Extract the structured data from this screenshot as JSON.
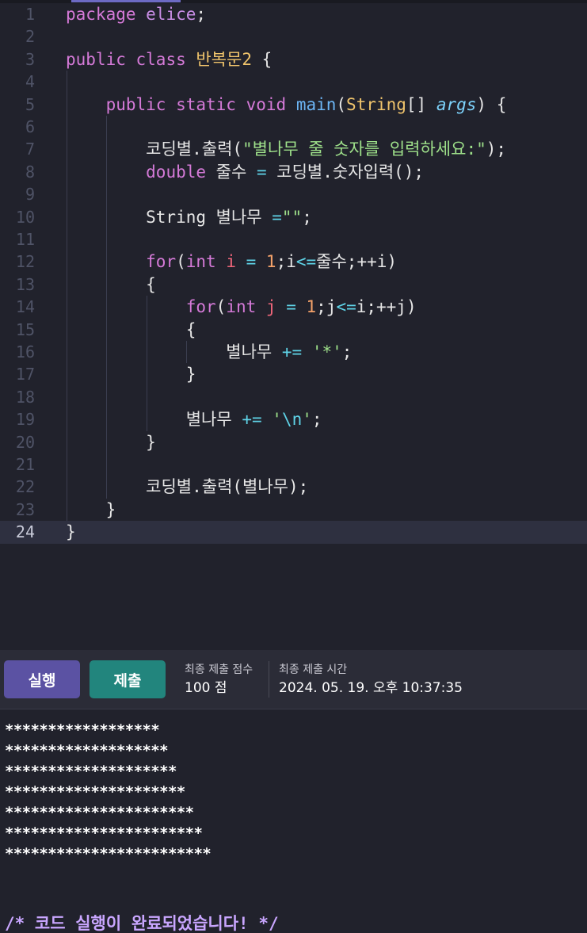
{
  "editor": {
    "active_line": 24,
    "lines": [
      {
        "n": "1",
        "tokens": [
          {
            "t": "package ",
            "c": "kw"
          },
          {
            "t": "elice",
            "c": "mod"
          },
          {
            "t": ";",
            "c": "plain"
          }
        ]
      },
      {
        "n": "2",
        "tokens": []
      },
      {
        "n": "3",
        "tokens": [
          {
            "t": "public ",
            "c": "kw"
          },
          {
            "t": "class ",
            "c": "kw"
          },
          {
            "t": "반복문2",
            "c": "cls"
          },
          {
            "t": " {",
            "c": "plain"
          }
        ]
      },
      {
        "n": "4",
        "tokens": []
      },
      {
        "n": "5",
        "tokens": [
          {
            "t": "    public ",
            "c": "kw"
          },
          {
            "t": "static ",
            "c": "kw"
          },
          {
            "t": "void ",
            "c": "kw"
          },
          {
            "t": "main",
            "c": "fn"
          },
          {
            "t": "(",
            "c": "plain"
          },
          {
            "t": "String",
            "c": "type"
          },
          {
            "t": "[] ",
            "c": "plain"
          },
          {
            "t": "args",
            "c": "param"
          },
          {
            "t": ") {",
            "c": "plain"
          }
        ]
      },
      {
        "n": "6",
        "tokens": []
      },
      {
        "n": "7",
        "tokens": [
          {
            "t": "        코딩별.출력(",
            "c": "plain"
          },
          {
            "t": "\"별나무 줄 숫자를 입력하세요:\"",
            "c": "str"
          },
          {
            "t": ");",
            "c": "plain"
          }
        ]
      },
      {
        "n": "8",
        "tokens": [
          {
            "t": "        ",
            "c": "plain"
          },
          {
            "t": "double ",
            "c": "kw"
          },
          {
            "t": "줄수 ",
            "c": "plain"
          },
          {
            "t": "=",
            "c": "op"
          },
          {
            "t": " 코딩별.숫자입력();",
            "c": "plain"
          }
        ]
      },
      {
        "n": "9",
        "tokens": []
      },
      {
        "n": "10",
        "tokens": [
          {
            "t": "        String 별나무 ",
            "c": "plain"
          },
          {
            "t": "=",
            "c": "op"
          },
          {
            "t": "\"\"",
            "c": "str"
          },
          {
            "t": ";",
            "c": "plain"
          }
        ]
      },
      {
        "n": "11",
        "tokens": []
      },
      {
        "n": "12",
        "tokens": [
          {
            "t": "        ",
            "c": "plain"
          },
          {
            "t": "for",
            "c": "kw"
          },
          {
            "t": "(",
            "c": "plain"
          },
          {
            "t": "int ",
            "c": "kw"
          },
          {
            "t": "i",
            "c": "var"
          },
          {
            "t": " = ",
            "c": "op"
          },
          {
            "t": "1",
            "c": "num"
          },
          {
            "t": ";i",
            "c": "plain"
          },
          {
            "t": "<=",
            "c": "op"
          },
          {
            "t": "줄수;++i)",
            "c": "plain"
          }
        ]
      },
      {
        "n": "13",
        "tokens": [
          {
            "t": "        {",
            "c": "plain"
          }
        ]
      },
      {
        "n": "14",
        "tokens": [
          {
            "t": "            ",
            "c": "plain"
          },
          {
            "t": "for",
            "c": "kw"
          },
          {
            "t": "(",
            "c": "plain"
          },
          {
            "t": "int ",
            "c": "kw"
          },
          {
            "t": "j",
            "c": "var"
          },
          {
            "t": " = ",
            "c": "op"
          },
          {
            "t": "1",
            "c": "num"
          },
          {
            "t": ";j",
            "c": "plain"
          },
          {
            "t": "<=",
            "c": "op"
          },
          {
            "t": "i;++j)",
            "c": "plain"
          }
        ]
      },
      {
        "n": "15",
        "tokens": [
          {
            "t": "            {",
            "c": "plain"
          }
        ]
      },
      {
        "n": "16",
        "tokens": [
          {
            "t": "                별나무 ",
            "c": "plain"
          },
          {
            "t": "+=",
            "c": "op"
          },
          {
            "t": " ",
            "c": "plain"
          },
          {
            "t": "'*'",
            "c": "str"
          },
          {
            "t": ";",
            "c": "plain"
          }
        ]
      },
      {
        "n": "17",
        "tokens": [
          {
            "t": "            }",
            "c": "plain"
          }
        ]
      },
      {
        "n": "18",
        "tokens": []
      },
      {
        "n": "19",
        "tokens": [
          {
            "t": "            별나무 ",
            "c": "plain"
          },
          {
            "t": "+=",
            "c": "op"
          },
          {
            "t": " ",
            "c": "plain"
          },
          {
            "t": "'",
            "c": "str"
          },
          {
            "t": "\\n",
            "c": "esc"
          },
          {
            "t": "'",
            "c": "str"
          },
          {
            "t": ";",
            "c": "plain"
          }
        ]
      },
      {
        "n": "20",
        "tokens": [
          {
            "t": "        }",
            "c": "plain"
          }
        ]
      },
      {
        "n": "21",
        "tokens": []
      },
      {
        "n": "22",
        "tokens": [
          {
            "t": "        코딩별.출력(별나무);",
            "c": "plain"
          }
        ]
      },
      {
        "n": "23",
        "tokens": [
          {
            "t": "    }",
            "c": "plain"
          }
        ]
      },
      {
        "n": "24",
        "tokens": [
          {
            "t": "}",
            "c": "plain"
          }
        ]
      }
    ]
  },
  "toolbar": {
    "run_label": "실행",
    "submit_label": "제출",
    "score_label": "최종 제출 점수",
    "score_value": "100 점",
    "time_label": "최종 제출 시간",
    "time_value": "2024. 05. 19. 오후 10:37:35"
  },
  "console": {
    "output_lines": [
      "******************",
      "*******************",
      "********************",
      "*********************",
      "**********************",
      "***********************",
      "************************"
    ],
    "done_message": "/* 코드 실행이 완료되었습니다! */"
  },
  "colors": {
    "background": "#21222c",
    "run_button": "#5b52a3",
    "submit_button": "#22857d",
    "keyword": "#d57ad8",
    "string": "#9ee08a",
    "console_done": "#c9a6ff"
  }
}
